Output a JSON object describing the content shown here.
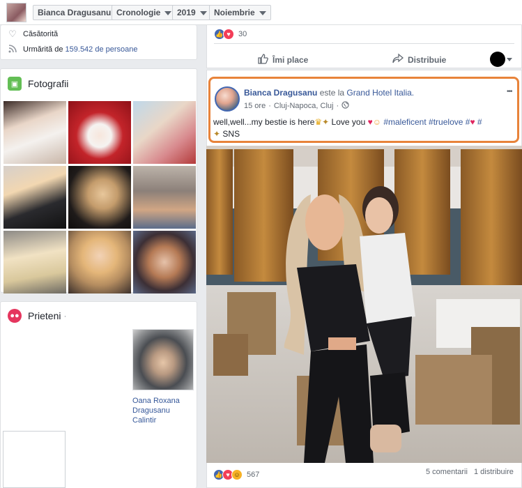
{
  "topbar": {
    "profile_name": "Bianca Dragusanu",
    "timeline": "Cronologie",
    "year": "2019",
    "month": "Noiembrie"
  },
  "intro": {
    "relationship": "Căsătorită",
    "followed_prefix": "Urmărită de",
    "followed_count": "159.542",
    "followed_suffix": "de persoane"
  },
  "photos": {
    "title": "Fotografii"
  },
  "friends": {
    "title": "Prieteni",
    "dot": "·",
    "friend_name_l1": "Oana Roxana",
    "friend_name_l2": "Dragusanu",
    "friend_name_l3": "Calintir"
  },
  "prev_post": {
    "reaction_count": "30",
    "like_label": "Îmi place",
    "share_label": "Distribuie"
  },
  "post": {
    "author": "Bianca Dragusanu",
    "at_text": " este la ",
    "place": "Grand Hotel Italia.",
    "time": "15 ore",
    "location": "Cluj-Napoca, Cluj",
    "text_part1": "well,well...my bestie is here",
    "text_part2": " Love you ",
    "tag1": "#maleficent",
    "tag2": "#truelove",
    "tag3": "#",
    "tag4": "#",
    "sns": " SNS",
    "more": "•••",
    "reaction_count": "567",
    "comments": "5 comentarii",
    "shares": "1 distribuire"
  },
  "colors": {
    "accent": "#4267b2",
    "highlight_border": "#e8833a",
    "link": "#385898"
  }
}
